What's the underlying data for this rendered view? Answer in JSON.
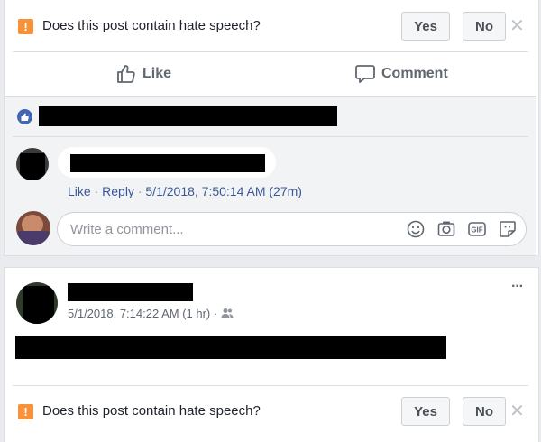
{
  "question_bar_top": {
    "question": "Does this post contain hate speech?",
    "yes_label": "Yes",
    "no_label": "No"
  },
  "post_actions": {
    "like_label": "Like",
    "comment_label": "Comment"
  },
  "comment": {
    "like_label": "Like",
    "separator": "·",
    "reply_label": "Reply",
    "timestamp": "5/1/2018, 7:50:14 AM (27m)"
  },
  "comment_composer": {
    "placeholder": "Write a comment..."
  },
  "post2": {
    "timestamp": "5/1/2018, 7:14:22 AM (1 hr)",
    "separator": "·",
    "more_label": "···"
  },
  "question_bar_bottom": {
    "question": "Does this post contain hate speech?",
    "yes_label": "Yes",
    "no_label": "No"
  },
  "colors": {
    "brand_blue": "#4267b2",
    "link_blue": "#385898",
    "warning_orange": "#f7923a",
    "background": "#e9ebee"
  }
}
